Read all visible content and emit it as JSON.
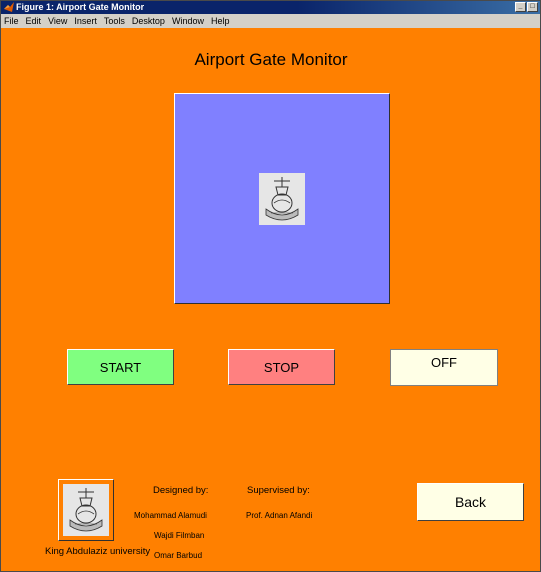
{
  "window": {
    "title": "Figure 1: Airport Gate Monitor",
    "controls": [
      "_",
      "□"
    ]
  },
  "menu": [
    "File",
    "Edit",
    "View",
    "Insert",
    "Tools",
    "Desktop",
    "Window",
    "Help"
  ],
  "heading": "Airport Gate Monitor",
  "buttons": {
    "start": "START",
    "stop": "STOP",
    "off": "OFF",
    "back": "Back"
  },
  "credits": {
    "university": "King Abdulaziz university",
    "designed_by_label": "Designed by:",
    "designers": [
      "Mohammad Alamudi",
      "Wajdi Filmban",
      "Omar Barbud"
    ],
    "supervised_by_label": "Supervised by:",
    "supervisor": "Prof. Adnan Afandi"
  },
  "colors": {
    "background": "#ff8000",
    "panel": "#8080ff",
    "start": "#80ff80",
    "stop": "#ff8080",
    "off": "#ffffe6"
  }
}
